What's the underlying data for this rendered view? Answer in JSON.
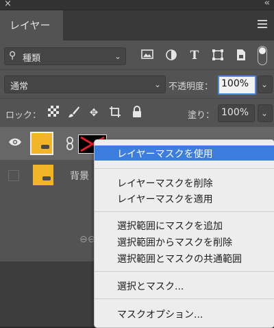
{
  "window": {
    "close_glyph": "×",
    "collapse_glyph": "‹‹"
  },
  "panel_tab": {
    "label": "レイヤー"
  },
  "filter": {
    "kind_label": "種類",
    "icons": [
      "image-filter-icon",
      "adjustment-filter-icon",
      "type-filter-icon",
      "shape-filter-icon",
      "smart-object-filter-icon"
    ]
  },
  "blend": {
    "mode": "通常",
    "opacity_label": "不透明度：",
    "opacity_value": "100%"
  },
  "lock": {
    "label": "ロック：",
    "fill_label": "塗り：",
    "fill_value": "100%"
  },
  "layers": [
    {
      "name": "",
      "visible": true,
      "has_mask": true
    },
    {
      "name": "背景",
      "visible": false,
      "has_mask": false
    }
  ],
  "context_menu": {
    "items": [
      {
        "label": "レイヤーマスクを使用",
        "highlighted": true
      },
      {
        "label": "レイヤーマスクを削除"
      },
      {
        "label": "レイヤーマスクを適用"
      },
      {
        "label": "選択範囲にマスクを追加"
      },
      {
        "label": "選択範囲からマスクを削除"
      },
      {
        "label": "選択範囲とマスクの共通範囲"
      },
      {
        "label": "選択とマスク..."
      },
      {
        "label": "マスクオプション..."
      }
    ]
  },
  "colors": {
    "accent": "#3d7ddd",
    "panel_bg": "#535353",
    "selected_layer": "#676767",
    "thumb_yellow": "#f2b527",
    "mask_x": "#e0202a"
  }
}
